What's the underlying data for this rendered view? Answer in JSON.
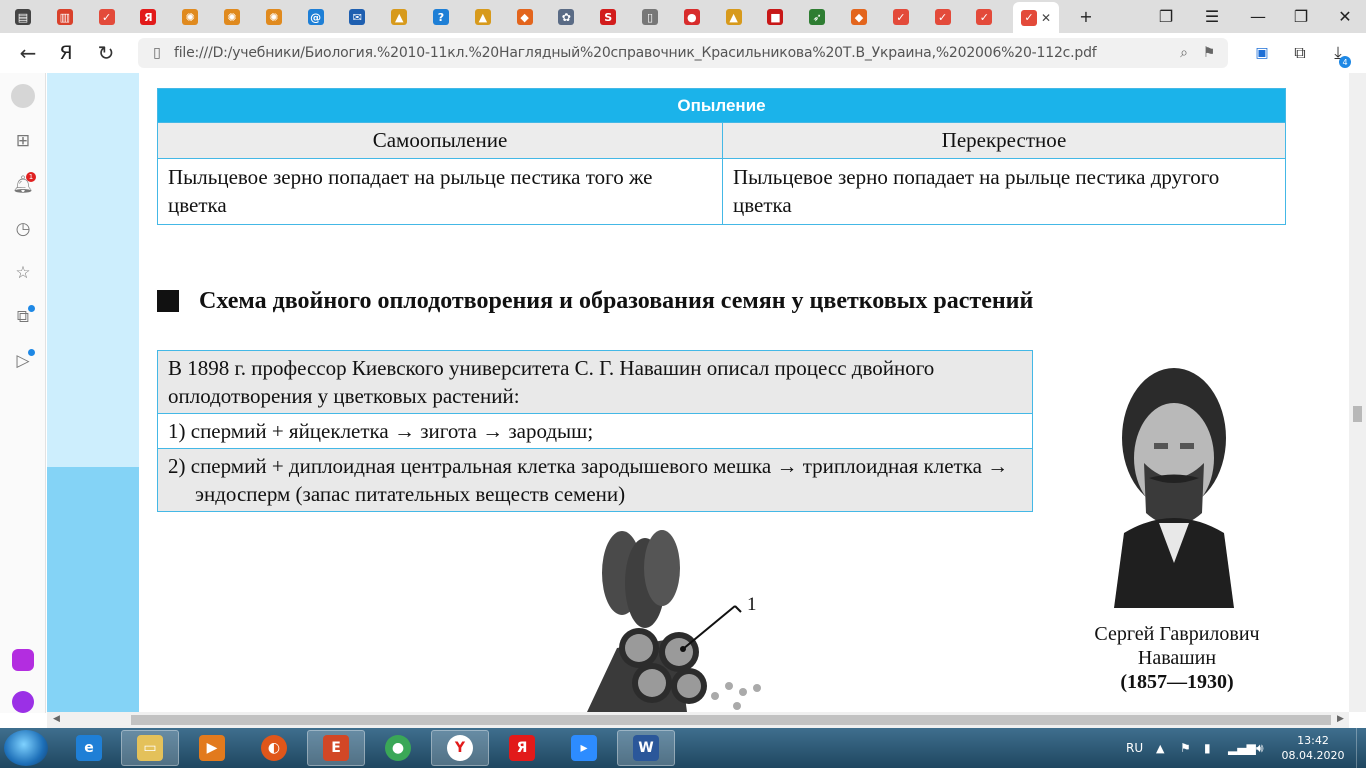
{
  "browser": {
    "tabs": [
      {
        "icon": "panel-icon",
        "color": "#444444"
      },
      {
        "icon": "chart-icon",
        "color": "#d9412b"
      },
      {
        "icon": "shield-icon",
        "color": "#e34a3a"
      },
      {
        "icon": "yandex-icon",
        "color": "#e21a1a"
      },
      {
        "icon": "wheel-icon",
        "color": "#e08a1e"
      },
      {
        "icon": "wheel-icon",
        "color": "#e08a1e"
      },
      {
        "icon": "wheel-icon",
        "color": "#e08a1e"
      },
      {
        "icon": "mail-at-icon",
        "color": "#1e7fd6"
      },
      {
        "icon": "envelope-icon",
        "color": "#1e5fb0"
      },
      {
        "icon": "image-icon",
        "color": "#d79a1c"
      },
      {
        "icon": "question-icon",
        "color": "#1e7fd6"
      },
      {
        "icon": "image-icon",
        "color": "#d79a1c"
      },
      {
        "icon": "fox-icon",
        "color": "#e3651d"
      },
      {
        "icon": "gear-icon",
        "color": "#5a6b85"
      },
      {
        "icon": "s-icon",
        "color": "#d21c1c"
      },
      {
        "icon": "page-icon",
        "color": "#777777"
      },
      {
        "icon": "record-icon",
        "color": "#d82c2c"
      },
      {
        "icon": "image-icon",
        "color": "#d79a1c"
      },
      {
        "icon": "stop-icon",
        "color": "#c81818"
      },
      {
        "icon": "runner-icon",
        "color": "#2e7d32"
      },
      {
        "icon": "fox-icon",
        "color": "#e3651d"
      },
      {
        "icon": "shield-icon",
        "color": "#e34a3a"
      },
      {
        "icon": "shield-icon",
        "color": "#e34a3a"
      },
      {
        "icon": "shield-icon",
        "color": "#e34a3a"
      }
    ],
    "url": "file:///D:/учебники/Биология.%2010-11кл.%20Наглядный%20справочник_Красильникова%20Т.В_Украина,%202006%20-112с.pdf",
    "yandex_letter": "Я",
    "downloads_badge": "4",
    "notifications_badge": "1"
  },
  "document": {
    "pollination_table": {
      "title": "Опыление",
      "col1_header": "Самоопыление",
      "col2_header": "Перекрестное",
      "col1_text": "Пыльцевое зерно попадает на рыльце пестика того же цветка",
      "col2_text": "Пыльцевое зерно попадает на рыльце пестика другого цветка"
    },
    "section_heading": "Схема двойного оплодотворения и образования семян у цветковых растений",
    "navashin_table": {
      "intro": "В 1898 г. профессор Киевского университета С. Г. Навашин описал процесс двойного оплодотворения у цветковых растений:",
      "step1": "1) спермий + яйцеклетка → зигота → зародыш;",
      "step2": "2) спермий + диплоидная центральная клетка зародышевого мешка → триплоидная клетка → эндосперм (запас питательных веществ семени)"
    },
    "portrait_caption": {
      "line1": "Сергей Гаврилович",
      "line2": "Навашин",
      "line3": "(1857—1930)"
    },
    "figure_label": "1"
  },
  "taskbar": {
    "language": "RU",
    "time": "13:42",
    "date": "08.04.2020"
  }
}
